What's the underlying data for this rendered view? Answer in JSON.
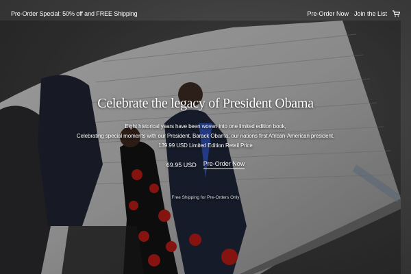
{
  "header": {
    "promo": "Pre-Order Special: 50% off and FREE Shipping",
    "nav": {
      "preorder": "Pre-Order Now",
      "join": "Join the List"
    }
  },
  "hero": {
    "title": "Celebrate the legacy of President Obama",
    "line1": "Eight historical years have been woven into one limited edition book,",
    "line2": "Celebrating special moments with our President, Barack Obama, our nations first African-American president.",
    "line3": "139.99 USD Limited Edition Retail Price",
    "price": "69.95 USD",
    "cta": "Pre-Order Now",
    "shipping_note": "Free Shipping for Pre-Orders Only"
  },
  "icons": {
    "cart": "cart-icon"
  }
}
